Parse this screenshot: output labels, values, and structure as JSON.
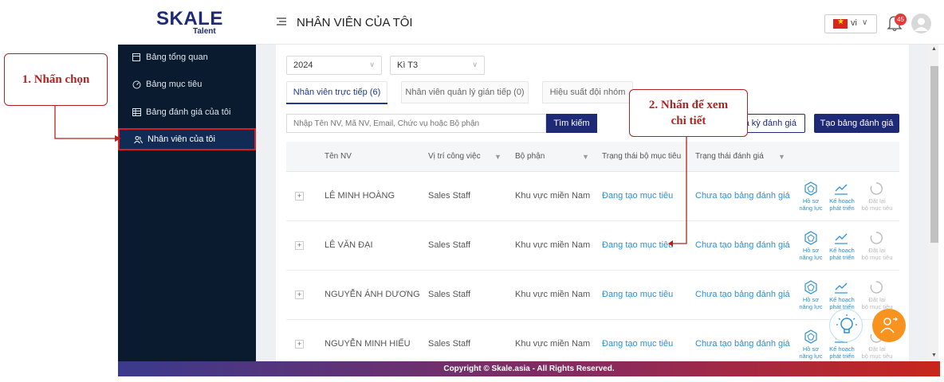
{
  "logo": {
    "brand": "SKALE",
    "sub": "Talent"
  },
  "sidebar": {
    "items": [
      {
        "label": "Bảng tổng quan",
        "icon": "dashboard-icon"
      },
      {
        "label": "Bảng mục tiêu",
        "icon": "target-icon"
      },
      {
        "label": "Bảng đánh giá của tôi",
        "icon": "table-icon"
      },
      {
        "label": "Nhân viên của tôi",
        "icon": "users-icon",
        "active": true
      }
    ]
  },
  "header": {
    "title": "NHÂN VIÊN CỦA TÔI",
    "lang": "vi",
    "notification_count": "45"
  },
  "filters": {
    "year": "2024",
    "period": "Kì T3"
  },
  "tabs": [
    {
      "label": "Nhân viên trực tiếp (6)",
      "active": true
    },
    {
      "label": "Nhân viên quản lý gián tiếp (0)"
    },
    {
      "label": "Hiệu suất đội nhóm"
    }
  ],
  "search": {
    "placeholder": "Nhập Tên NV, Mã NV, Email, Chức vụ hoặc Bộ phận",
    "button": "Tìm kiếm"
  },
  "actions": {
    "period_button": "a kỳ đánh giá",
    "create_button": "Tạo bảng đánh giá"
  },
  "table": {
    "headers": [
      "Tên NV",
      "Vị trí công việc",
      "Bộ phận",
      "Trạng thái bộ mục tiêu",
      "Trạng thái đánh giá"
    ],
    "rows": [
      {
        "name": "LÊ MINH HOÀNG",
        "position": "Sales Staff",
        "dept": "Khu vực miền Nam",
        "goal_status": "Đang tạo mục tiêu",
        "review_status": "Chưa tạo bảng đánh giá"
      },
      {
        "name": "LÊ VĂN ĐẠI",
        "position": "Sales Staff",
        "dept": "Khu vực miền Nam",
        "goal_status": "Đang tạo mục tiêu",
        "review_status": "Chưa tạo bảng đánh giá"
      },
      {
        "name": "NGUYỄN ÁNH DƯƠNG",
        "position": "Sales Staff",
        "dept": "Khu vực miền Nam",
        "goal_status": "Đang tạo mục tiêu",
        "review_status": "Chưa tạo bảng đánh giá"
      },
      {
        "name": "NGUYỄN MINH HIẾU",
        "position": "Sales Staff",
        "dept": "Khu vực miền Nam",
        "goal_status": "Đang tạo mục tiêu",
        "review_status": "Chưa tạo bảng đánh giá"
      }
    ],
    "row_actions": {
      "profile": [
        "Hồ sơ",
        "năng lực"
      ],
      "plan": [
        "Kế hoạch",
        "phát triển"
      ],
      "reset": [
        "Đặt lại",
        "bộ mục tiêu"
      ]
    }
  },
  "annotations": {
    "step1": "1. Nhấn chọn",
    "step2_line1": "2. Nhấn để xem",
    "step2_line2": "chi tiết"
  },
  "footer": "Copyright © Skale.asia - All Rights Reserved.",
  "colors": {
    "primary": "#1e2a78",
    "link": "#2d8fd5",
    "sidebar": "#0a1a2f",
    "annotation": "#b22222",
    "fab": "#f7931e"
  }
}
